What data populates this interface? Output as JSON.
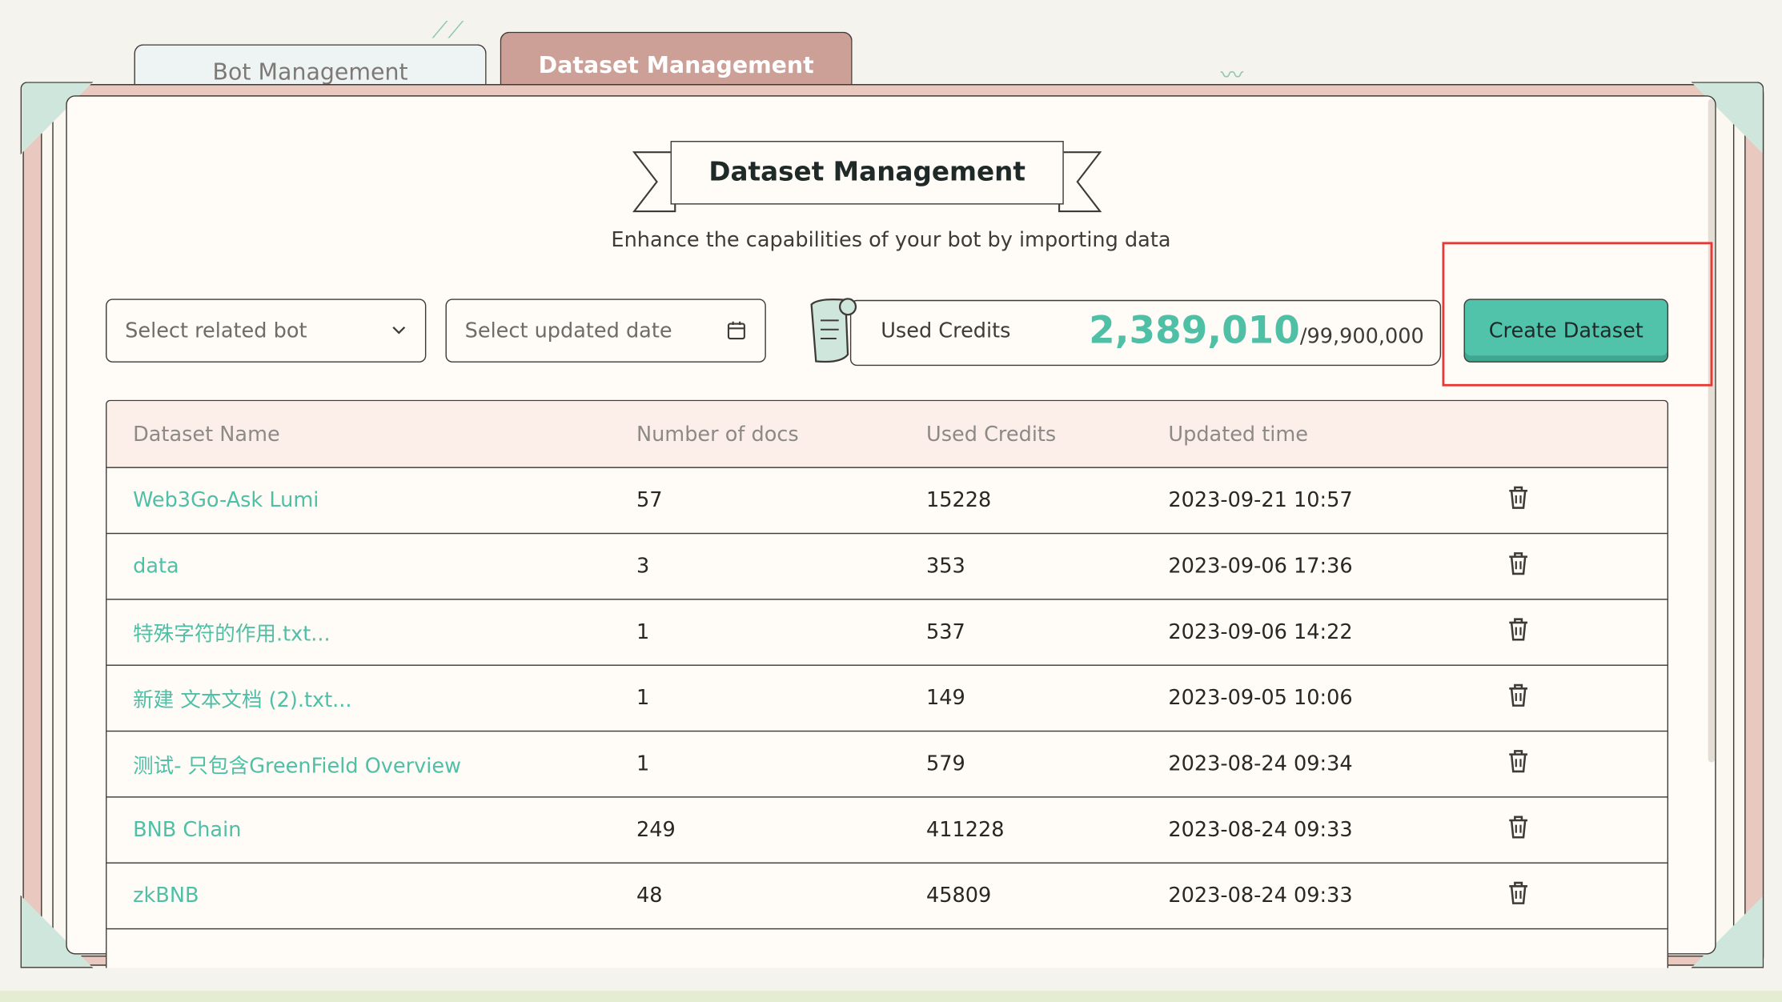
{
  "tabs": [
    {
      "label": "Bot Management",
      "active": false
    },
    {
      "label": "Dataset Management",
      "active": true
    }
  ],
  "header": {
    "title": "Dataset Management",
    "subtitle": "Enhance the capabilities of your bot by importing data"
  },
  "filters": {
    "bot_placeholder": "Select related bot",
    "date_placeholder": "Select updated date"
  },
  "credits": {
    "label": "Used Credits",
    "used": "2,389,010",
    "total": "/99,900,000"
  },
  "actions": {
    "create_label": "Create Dataset"
  },
  "table": {
    "columns": [
      "Dataset Name",
      "Number of docs",
      "Used Credits",
      "Updated time"
    ],
    "rows": [
      {
        "name": "Web3Go-Ask Lumi",
        "docs": "57",
        "credits": "15228",
        "updated": "2023-09-21 10:57"
      },
      {
        "name": "data",
        "docs": "3",
        "credits": "353",
        "updated": "2023-09-06 17:36"
      },
      {
        "name": "特殊字符的作用.txt...",
        "docs": "1",
        "credits": "537",
        "updated": "2023-09-06 14:22"
      },
      {
        "name": "新建 文本文档 (2).txt...",
        "docs": "1",
        "credits": "149",
        "updated": "2023-09-05 10:06"
      },
      {
        "name": "测试- 只包含GreenField Overview",
        "docs": "1",
        "credits": "579",
        "updated": "2023-08-24 09:34"
      },
      {
        "name": "BNB Chain",
        "docs": "249",
        "credits": "411228",
        "updated": "2023-08-24 09:33"
      },
      {
        "name": "zkBNB",
        "docs": "48",
        "credits": "45809",
        "updated": "2023-08-24 09:33"
      }
    ]
  },
  "icons": {
    "dropdown": "chevron-down-icon",
    "calendar": "calendar-icon",
    "delete": "trash-icon",
    "credits": "scroll-icon"
  },
  "colors": {
    "accent": "#52c3ab",
    "link": "#4fbfa6",
    "active_tab": "#cc9f97",
    "highlight": "#e53935"
  }
}
